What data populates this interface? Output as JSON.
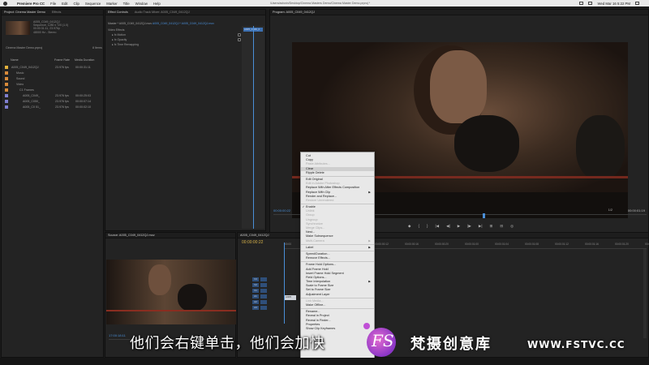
{
  "menubar": {
    "app_name": "Premiere Pro CC",
    "items": [
      "File",
      "Edit",
      "Clip",
      "Sequence",
      "Marker",
      "Title",
      "Window",
      "Help"
    ],
    "path": "/Users/ashwin/Desktop/Cinema Masters Demo/Cinema Master Demo.prproj *",
    "clock": "Wed Mar 16  5:22 PM"
  },
  "project_panel": {
    "tabs": [
      "Project: Cinema Master Demo",
      "Effects"
    ],
    "clip_info": {
      "name": "A005_C049_0412QJ",
      "line1": "Sequence, 1280 x 720 (1.0)",
      "line2": "00:00:31:11, 23.976p",
      "line3": "48000 Hz - Stereo"
    },
    "project_file": "Cinema Master Demo.prproj",
    "item_count": "8 Items",
    "columns": [
      "Name",
      "Frame Rate",
      "Media Duration"
    ],
    "rows": [
      {
        "name": "A005_C049_0412QJ",
        "rate": "23.976 fps",
        "dur": "00:00:31:11",
        "color": "#e3b13c"
      },
      {
        "name": "Music",
        "rate": "",
        "dur": "",
        "color": "#d98b3a"
      },
      {
        "name": "Sound",
        "rate": "",
        "dur": "",
        "color": "#d98b3a"
      },
      {
        "name": "Video",
        "rate": "",
        "dur": "",
        "color": "#d98b3a"
      },
      {
        "name": "C1 Frames",
        "rate": "",
        "dur": "",
        "color": "#d98b3a"
      },
      {
        "name": "A005_C049_",
        "rate": "23.976 fps",
        "dur": "00:00:25:03",
        "color": "#7f7fcf"
      },
      {
        "name": "A005_C050_",
        "rate": "23.976 fps",
        "dur": "00:00:07:14",
        "color": "#7f7fcf"
      },
      {
        "name": "A005_C0 51_",
        "rate": "23.976 fps",
        "dur": "00:00:02:10",
        "color": "#7f7fcf"
      }
    ]
  },
  "effects_panel": {
    "tabs": [
      "Effect Controls",
      "Audio Track Mixer: A005_C049_0412QJ"
    ],
    "source_path": "Master * A005_C049_0412QJ.mov",
    "sequence_path": "A005_C049_0412QJ * A005_C049_0412QJ.mov",
    "section": "Video Effects",
    "effects": [
      "Motion",
      "Opacity",
      "Time Remapping"
    ],
    "mini_clip": "A005_C049_0"
  },
  "program_monitor": {
    "tab": "Program: A005_C049_0412QJ",
    "timecode": "00:00:00:22",
    "fit": "1/2",
    "duration": "00:00:01:19",
    "transport": [
      "◆",
      "{",
      "}",
      "|◀",
      "◀|",
      "▶",
      "|▶",
      "▶|",
      "⊞",
      "⊟",
      "◎"
    ]
  },
  "source_monitor": {
    "tab": "Source: A005_C049_0412QJ.mov",
    "timecode": "17:00:18:11"
  },
  "timeline": {
    "tab": "A005_C049_0412QJ",
    "timecode": "00:00:00:22",
    "ruler": [
      "00:00",
      "00:00:00:04",
      "00:00:00:08",
      "00:00:00:12",
      "00:00:00:16",
      "00:00:00:20",
      "00:00:01:00",
      "00:00:01:04",
      "00:00:01:08",
      "00:00:01:12",
      "00:00:01:16",
      "00:00:01:20",
      "00:00:02:00"
    ],
    "tracks": [
      "V3",
      "V2",
      "V1",
      "A1",
      "A2",
      "A3"
    ],
    "clip_label": "A005"
  },
  "context_menu": {
    "items": [
      {
        "label": "Cut",
        "state": "enabled"
      },
      {
        "label": "Copy",
        "state": "enabled"
      },
      {
        "label": "Paste Attributes...",
        "state": "disabled"
      },
      {
        "label": "Clear",
        "state": "highlighted"
      },
      {
        "label": "Ripple Delete",
        "state": "enabled"
      },
      {
        "sep": true
      },
      {
        "label": "Edit Original",
        "state": "enabled"
      },
      {
        "label": "Edit in Adobe Photoshop",
        "state": "disabled"
      },
      {
        "label": "Replace With After Effects Composition",
        "state": "enabled"
      },
      {
        "label": "Replace With Clip",
        "state": "enabled",
        "submenu": true
      },
      {
        "label": "Render and Replace...",
        "state": "enabled"
      },
      {
        "label": "Restore Unrendered",
        "state": "disabled"
      },
      {
        "sep": true
      },
      {
        "label": "Enable",
        "state": "checked"
      },
      {
        "label": "Unlink",
        "state": "disabled"
      },
      {
        "label": "Group",
        "state": "disabled"
      },
      {
        "label": "Ungroup",
        "state": "disabled"
      },
      {
        "label": "Synchronize",
        "state": "disabled"
      },
      {
        "label": "Merge Clips...",
        "state": "disabled"
      },
      {
        "label": "Nest...",
        "state": "enabled"
      },
      {
        "label": "Make Subsequence",
        "state": "enabled"
      },
      {
        "label": "Multi-Camera",
        "state": "disabled",
        "submenu": true
      },
      {
        "sep": true
      },
      {
        "label": "Label",
        "state": "enabled",
        "submenu": true
      },
      {
        "sep": true
      },
      {
        "label": "Speed/Duration...",
        "state": "enabled"
      },
      {
        "label": "Remove Effects...",
        "state": "enabled"
      },
      {
        "sep": true
      },
      {
        "label": "Frame Hold Options...",
        "state": "enabled"
      },
      {
        "label": "Add Frame Hold",
        "state": "enabled"
      },
      {
        "label": "Insert Frame Hold Segment",
        "state": "enabled"
      },
      {
        "label": "Field Options...",
        "state": "enabled"
      },
      {
        "label": "Time Interpolation",
        "state": "enabled",
        "submenu": true
      },
      {
        "label": "Scale to Frame Size",
        "state": "enabled"
      },
      {
        "label": "Set to Frame Size",
        "state": "enabled"
      },
      {
        "label": "Adjustment Layer",
        "state": "enabled"
      },
      {
        "sep": true
      },
      {
        "label": "Link Media...",
        "state": "disabled"
      },
      {
        "label": "Make Offline...",
        "state": "enabled"
      },
      {
        "sep": true
      },
      {
        "label": "Rename...",
        "state": "enabled"
      },
      {
        "label": "Reveal in Project",
        "state": "enabled"
      },
      {
        "label": "Reveal in Finder...",
        "state": "enabled"
      },
      {
        "label": "Properties",
        "state": "enabled"
      },
      {
        "label": "Show Clip Keyframes",
        "state": "enabled"
      }
    ]
  },
  "overlay": {
    "subtitle": "他们会右键单击，他们会加快",
    "logo_text": "FS",
    "brand": "梵摄创意库",
    "site": "WWW.FSTVC.CC"
  },
  "colors": {
    "accent": "#4a8fd8",
    "timecode_yellow": "#d7b24a",
    "menu_bg": "#e8e8e8",
    "logo": "#a04fd0"
  }
}
